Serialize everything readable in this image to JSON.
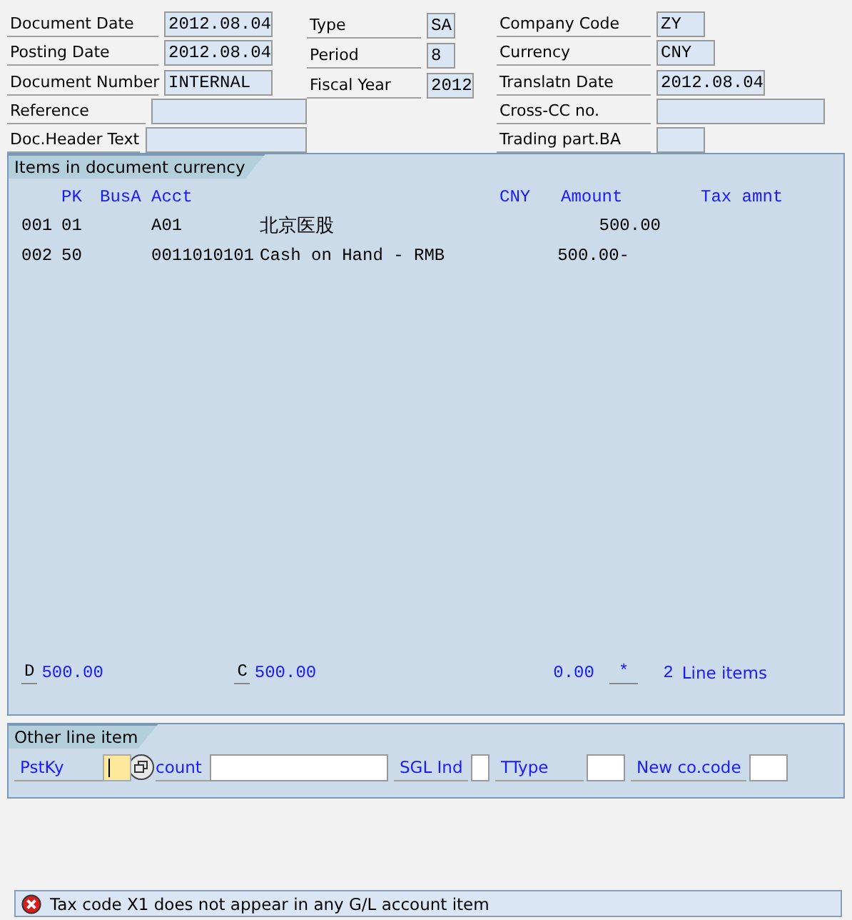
{
  "header": {
    "columns": [
      [
        {
          "label": "Document Date",
          "value": "2012.08.04"
        },
        {
          "label": "Posting Date",
          "value": "2012.08.04"
        },
        {
          "label": "Document Number",
          "value": "INTERNAL"
        },
        {
          "label": "Reference"
        },
        {
          "label": "Doc.Header Text"
        }
      ],
      [
        {
          "label": "Type",
          "value": "SA"
        },
        {
          "label": "Period",
          "value": "8"
        },
        {
          "label": "Fiscal Year",
          "value": "2012"
        }
      ],
      [
        {
          "label": "Company Code",
          "value": "ZY"
        },
        {
          "label": "Currency",
          "value": "CNY"
        },
        {
          "label": "Translatn Date",
          "value": "2012.08.04"
        },
        {
          "label": "Cross-CC no."
        },
        {
          "label": "Trading part.BA"
        }
      ]
    ]
  },
  "items": {
    "title": "Items in document currency",
    "columns": [
      "",
      "PK",
      "BusA",
      "Acct",
      "",
      "CNY",
      "Amount",
      "Tax amnt"
    ],
    "rows": [
      {
        "kind": "debit",
        "no": "001",
        "pk": "01",
        "acct": "A01",
        "text": "北京医股",
        "amount": "500.00"
      },
      {
        "kind": "credit",
        "no": "002",
        "pk": "50",
        "acct": "0011010101",
        "text": "Cash on Hand - RMB",
        "amount": "500.00-"
      }
    ],
    "totals": {
      "debit_label": "D",
      "debit": "500.00",
      "credit_label": "C",
      "credit": "500.00",
      "balance": "0.00",
      "balance_mark": "*",
      "count": "2",
      "count_label": "Line items"
    }
  },
  "other_line_item": {
    "title": "Other line item",
    "fields": [
      {
        "label": "PstKy",
        "kind": "focused"
      },
      {
        "label": "count",
        "kind": "account"
      },
      {
        "label": "SGL Ind",
        "kind": "small"
      },
      {
        "label": "TType",
        "kind": "medium"
      },
      {
        "label": "New co.code",
        "kind": "medium"
      }
    ]
  },
  "status_bar": {
    "error": true,
    "message": "Tax code X1 does not appear in any G/L account item"
  }
}
